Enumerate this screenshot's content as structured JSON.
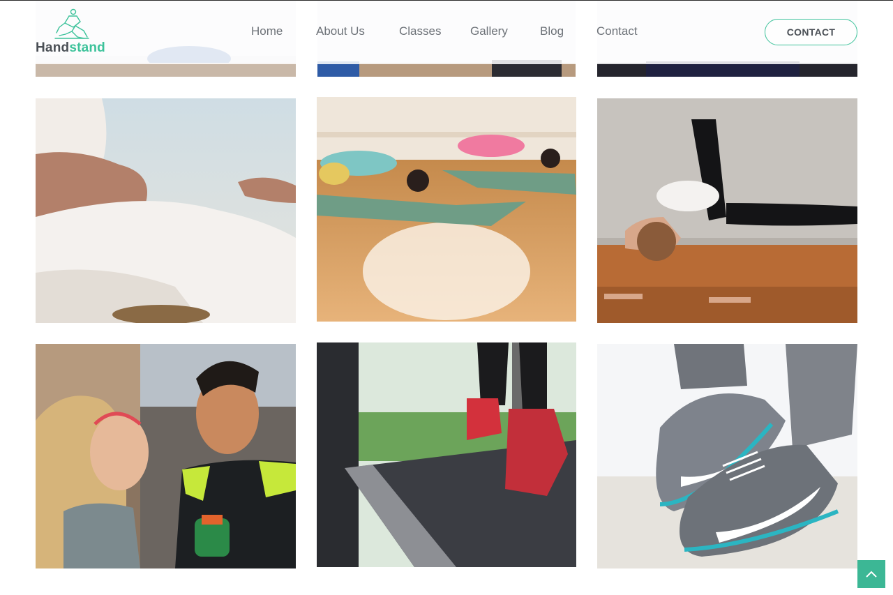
{
  "brand": {
    "name_part1": "Hand",
    "name_part2": "stand",
    "accent_color": "#3cc29a",
    "dark_color": "#4a4f55"
  },
  "nav": {
    "items": [
      {
        "label": "Home"
      },
      {
        "label": "About Us"
      },
      {
        "label": "Classes"
      },
      {
        "label": "Gallery"
      },
      {
        "label": "Blog"
      },
      {
        "label": "Contact"
      }
    ],
    "cta_label": "CONTACT"
  },
  "gallery": {
    "images": [
      {
        "subject": "yoga-mat-top-left"
      },
      {
        "subject": "yoga-mats-top-middle"
      },
      {
        "subject": "legs-top-right"
      },
      {
        "subject": "meditation-hands"
      },
      {
        "subject": "child-pose-yoga-class"
      },
      {
        "subject": "arm-balance-pose"
      },
      {
        "subject": "couple-smiling-fitness"
      },
      {
        "subject": "treadmill-running"
      },
      {
        "subject": "running-sneakers"
      }
    ]
  },
  "scroll_top": {
    "icon": "chevron-up-icon",
    "color": "#3cb795"
  }
}
